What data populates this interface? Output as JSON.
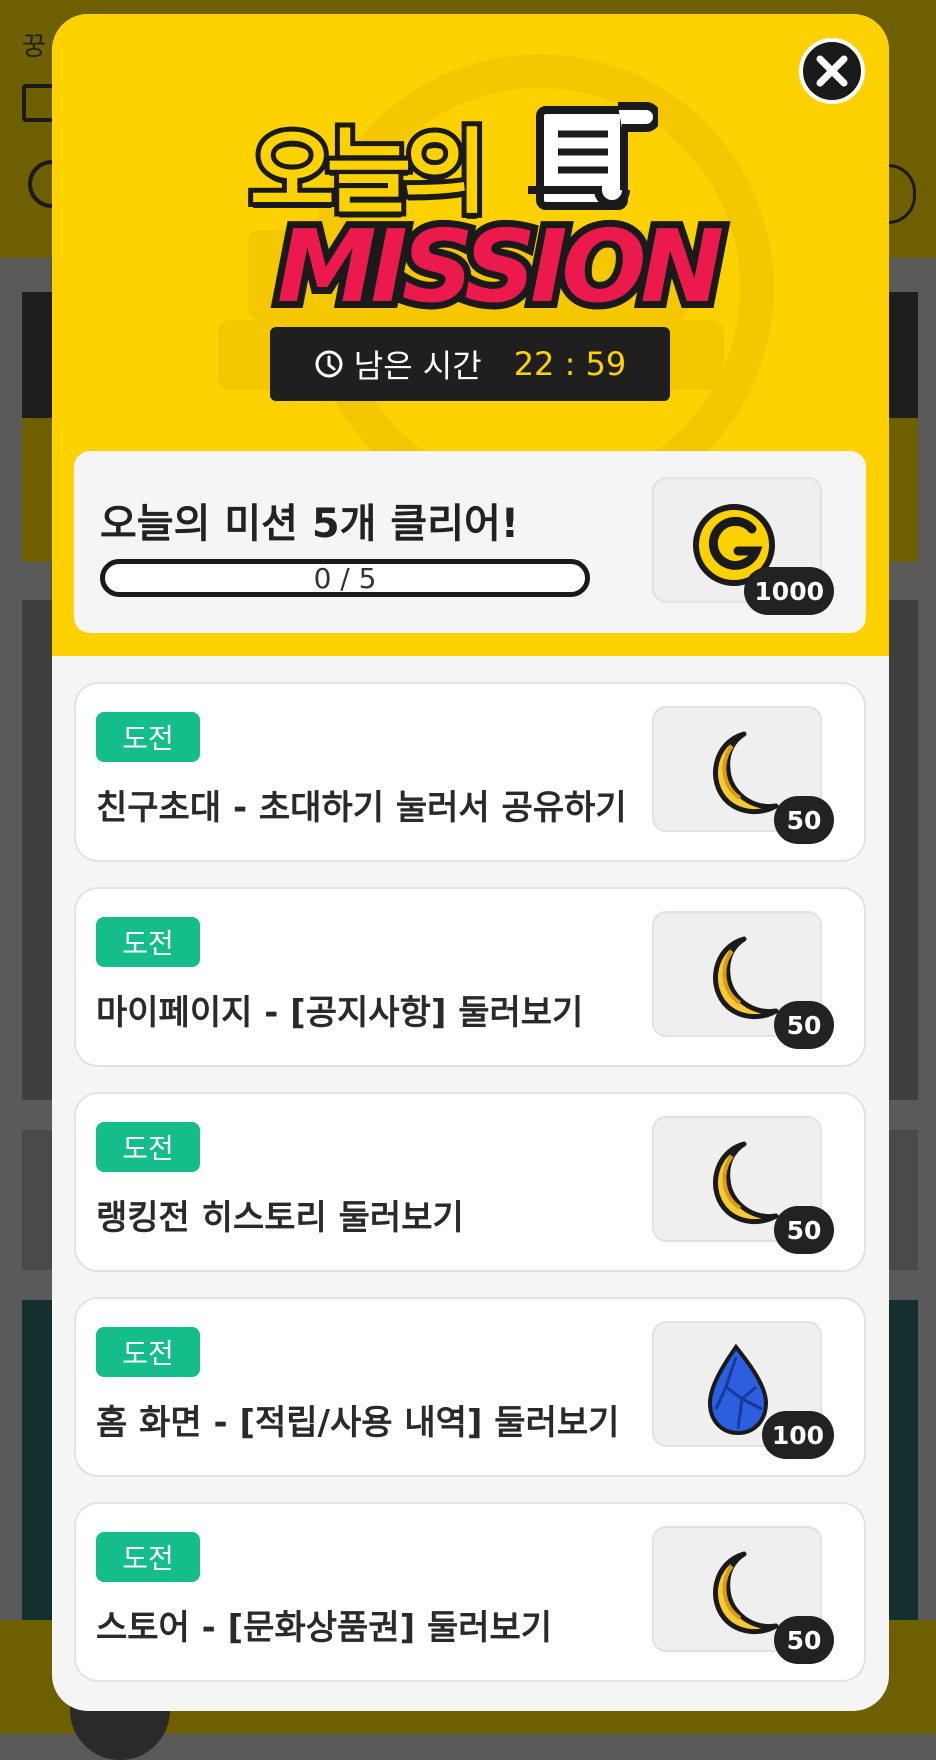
{
  "background": {
    "top_text": "꿍"
  },
  "header": {
    "title_korean": "오늘의",
    "title_english": "MISSION",
    "timer_label": "남은 시간",
    "timer_value": "22 : 59"
  },
  "summary": {
    "title": "오늘의 미션 5개 클리어!",
    "progress_text": "0 / 5",
    "progress_fraction": 0,
    "reward_icon": "gold-coin-icon",
    "reward_amount": "1000"
  },
  "missions": [
    {
      "tag": "도전",
      "title": "친구초대 - 초대하기 눌러서 공유하기",
      "reward_icon": "moon-icon",
      "reward_amount": "50"
    },
    {
      "tag": "도전",
      "title": "마이페이지 - [공지사항] 둘러보기",
      "reward_icon": "moon-icon",
      "reward_amount": "50"
    },
    {
      "tag": "도전",
      "title": "랭킹전 히스토리 둘러보기",
      "reward_icon": "moon-icon",
      "reward_amount": "50"
    },
    {
      "tag": "도전",
      "title": "홈 화면 - [적립/사용 내역] 둘러보기",
      "reward_icon": "gem-icon",
      "reward_amount": "100"
    },
    {
      "tag": "도전",
      "title": "스토어 - [문화상품권] 둘러보기",
      "reward_icon": "moon-icon",
      "reward_amount": "50"
    }
  ],
  "colors": {
    "brand_yellow": "#fdd200",
    "mission_red": "#ec1a4c",
    "tag_green": "#14bd8a",
    "dark": "#1f1f1f"
  }
}
